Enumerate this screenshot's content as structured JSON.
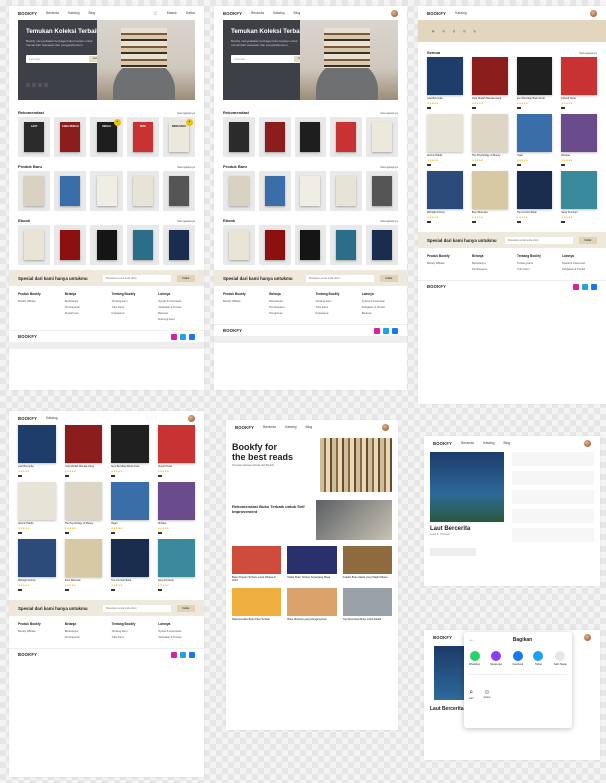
{
  "brand": "BOOKFY",
  "brand_display": "BOOKFY",
  "nav": {
    "home": "Beranda",
    "catalog": "Katalog",
    "blog": "Blog",
    "login": "Masuk",
    "signup": "Daftar"
  },
  "hero": {
    "title": "Temukan Koleksi Terbaik",
    "desc": "Bookfy menyediakan berbagai buku bacaan untuk menambah wawasan dan pengetahuanmu",
    "search_placeholder": "Cari buku...",
    "search_btn": "Cari"
  },
  "sections": {
    "rec": "Rekomendasi",
    "new": "Produk Baru",
    "ebook": "Ebook",
    "more": "Selengkapnya",
    "all": "Semua"
  },
  "special": {
    "title": "Spesial dari kami hanya untukmu",
    "placeholder": "Masukkan email anda disini",
    "button": "Daftar"
  },
  "footer": {
    "cols": [
      {
        "h": "Produk Bookfy",
        "items": [
          "Bookfy Affiliate"
        ]
      },
      {
        "h": "Belanja",
        "items": [
          "Berkelanjut",
          "Pembayaran",
          "Pengiriman"
        ]
      },
      {
        "h": "Tentang Bookfy",
        "items": [
          "Tentang kami",
          "Tulis Kami",
          "Kerjasama"
        ]
      },
      {
        "h": "Lainnya",
        "items": [
          "Syarat & Ketentuan",
          "Kebijakan & Privasi",
          "Bantuan",
          "Hubungi kami"
        ]
      }
    ]
  },
  "blog": {
    "title_line1": "Bookfy for",
    "title_line2": "the best reads",
    "subtitle": "Temukan bacaan terbaik dari Bookfy",
    "feature": "Rekomendasi Buku Terbaik untuk Self Improvement",
    "posts": [
      "Buku Populer Terbaru untuk Dibaca di 2023",
      "Daftar Buku Terlaris Sepanjang Masa",
      "Koleksi Buku Klasik yang Wajib Dibaca",
      "Rekomendasi Buku Fiksi Terbaik",
      "Buku Motivasi yang Menginspirasi",
      "Tips Membaca Buku Lebih Efektif"
    ]
  },
  "detail": {
    "title": "Laut Bercerita",
    "author": "Leila S. Chudori",
    "share_title": "Bagikan",
    "share_options": [
      "WhatsApp",
      "Messenger",
      "Facebook",
      "Twitter",
      "Salin Tautan"
    ],
    "share_extra": [
      "Cari",
      "Group"
    ]
  },
  "books": [
    {
      "t": "Laut Bercerita",
      "c": "#1f3d6b"
    },
    {
      "t": "Cara Mudah Menata Uang",
      "c": "#8c1d1d"
    },
    {
      "t": "Seni Bersikap Bodo Amat",
      "c": "#202020"
    },
    {
      "t": "Filosofi Teras",
      "c": "#c83232"
    },
    {
      "t": "Atomic Habits",
      "c": "#e7e3d7"
    },
    {
      "t": "The Psychology of Money",
      "c": "#ddd6c4"
    },
    {
      "t": "Hujan",
      "c": "#3a6ea8"
    },
    {
      "t": "Mindset",
      "c": "#6a4b8c"
    },
    {
      "t": "Midnight Library",
      "c": "#2c4a7a"
    },
    {
      "t": "Bumi Manusia",
      "c": "#d6c9a4"
    },
    {
      "t": "The Comfort Book",
      "c": "#1a2d4f"
    },
    {
      "t": "Sang Pemimpi",
      "c": "#3b8a9c"
    }
  ]
}
